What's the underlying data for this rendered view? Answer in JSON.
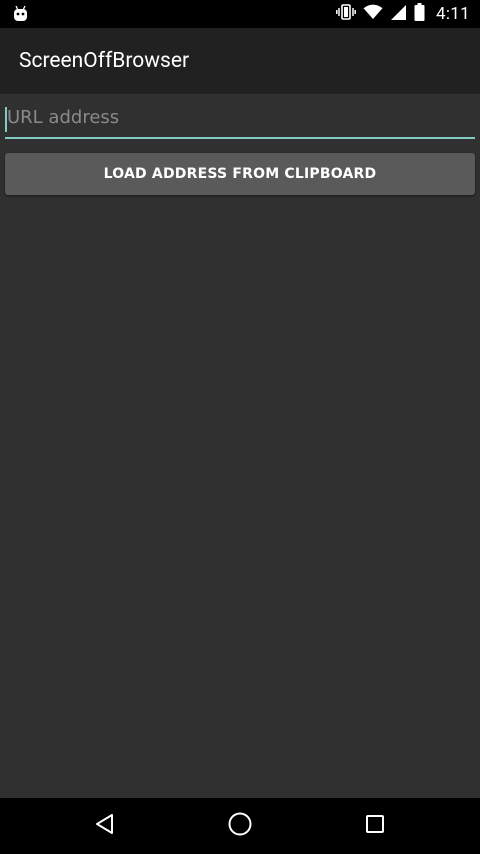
{
  "status_bar": {
    "time": "4:11",
    "left_icon": "android-robot-icon",
    "icons": [
      "vibrate-icon",
      "wifi-icon",
      "signal-icon",
      "battery-icon"
    ]
  },
  "app": {
    "title": "ScreenOffBrowser"
  },
  "form": {
    "url_value": "",
    "url_placeholder": "URL address",
    "load_button_label": "LOAD ADDRESS FROM CLIPBOARD"
  },
  "nav_bar": {
    "buttons": [
      "back-icon",
      "home-icon",
      "recents-icon"
    ]
  },
  "colors": {
    "background": "#303030",
    "action_bar": "#212121",
    "accent": "#80cbc4",
    "button": "#5a5a5a"
  }
}
